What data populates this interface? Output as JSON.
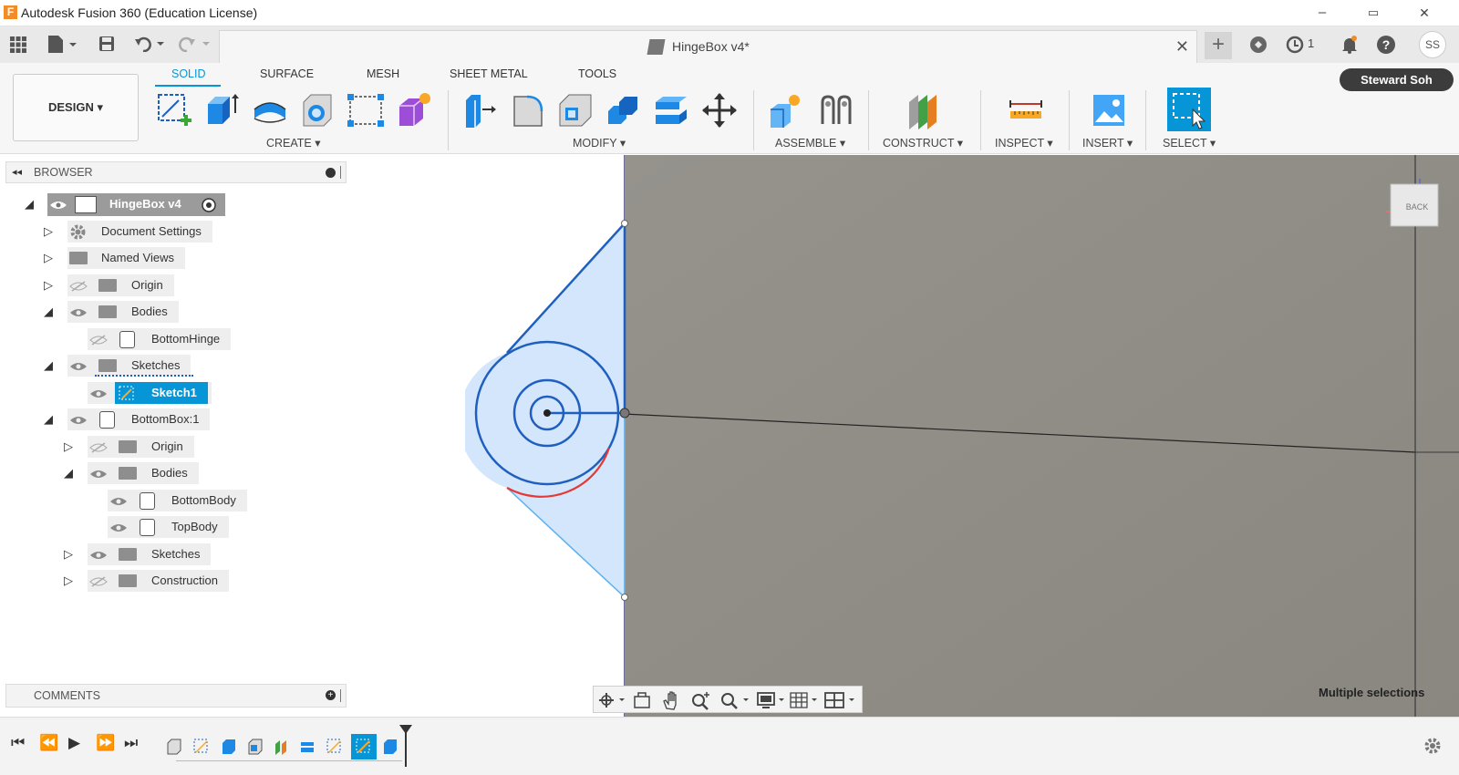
{
  "window": {
    "title": "Autodesk Fusion 360 (Education License)",
    "min": "–",
    "restore": "▭",
    "close": "✕"
  },
  "document_tab": {
    "title": "HingeBox v4*",
    "close": "✕"
  },
  "tabbar": {
    "job_count": "1",
    "user_initials": "SS",
    "user_name": "Steward Soh"
  },
  "workspace": {
    "label": "DESIGN ▾"
  },
  "ribbon_tabs": [
    "SOLID",
    "SURFACE",
    "MESH",
    "SHEET METAL",
    "TOOLS"
  ],
  "ribbon_groups": {
    "create": "CREATE ▾",
    "modify": "MODIFY ▾",
    "assemble": "ASSEMBLE ▾",
    "construct": "CONSTRUCT ▾",
    "inspect": "INSPECT ▾",
    "insert": "INSERT ▾",
    "select": "SELECT ▾"
  },
  "browser": {
    "title": "BROWSER",
    "items": [
      {
        "label": "HingeBox v4"
      },
      {
        "label": "Document Settings"
      },
      {
        "label": "Named Views"
      },
      {
        "label": "Origin"
      },
      {
        "label": "Bodies"
      },
      {
        "label": "BottomHinge"
      },
      {
        "label": "Sketches"
      },
      {
        "label": "Sketch1"
      },
      {
        "label": "BottomBox:1"
      },
      {
        "label": "Origin"
      },
      {
        "label": "Bodies"
      },
      {
        "label": "BottomBody"
      },
      {
        "label": "TopBody"
      },
      {
        "label": "Sketches"
      },
      {
        "label": "Construction"
      }
    ]
  },
  "comments": {
    "title": "COMMENTS"
  },
  "viewcube": {
    "face_label": "BACK"
  },
  "status": {
    "text": "Multiple selections"
  },
  "colors": {
    "accent": "#0696d7",
    "viewport": "#8f8d86",
    "sketch_fill": "#cce0fb",
    "sketch_line": "#1f5fbf"
  }
}
